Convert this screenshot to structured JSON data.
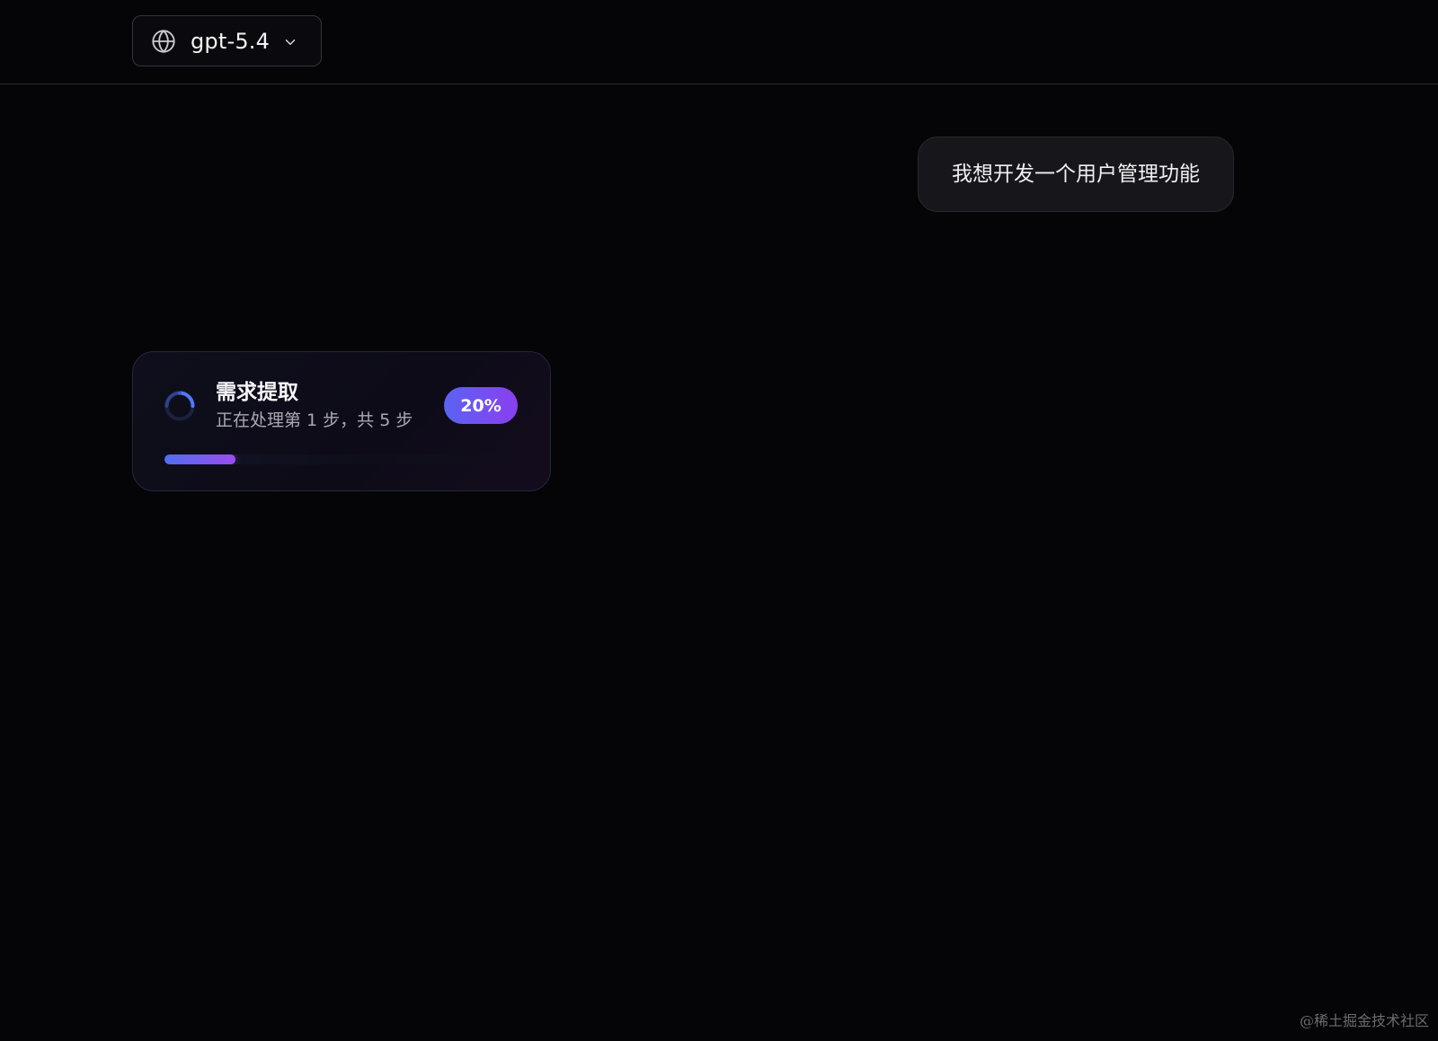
{
  "header": {
    "model_selector": {
      "icon": "globe-icon",
      "label": "gpt-5.4",
      "chevron_icon": "chevron-down-icon"
    }
  },
  "chat": {
    "user_message": "我想开发一个用户管理功能",
    "progress_card": {
      "icon": "spinner-icon",
      "title": "需求提取",
      "subtitle": "正在处理第 1 步，共 5 步",
      "percent_label": "20%",
      "progress_fraction": 0.2,
      "current_step": 1,
      "total_steps": 5
    }
  },
  "watermark": "@稀土掘金技术社区",
  "colors": {
    "background": "#050508",
    "accent_start": "#5a63f2",
    "accent_end": "#8a3ff0",
    "bubble": "#17171b"
  }
}
